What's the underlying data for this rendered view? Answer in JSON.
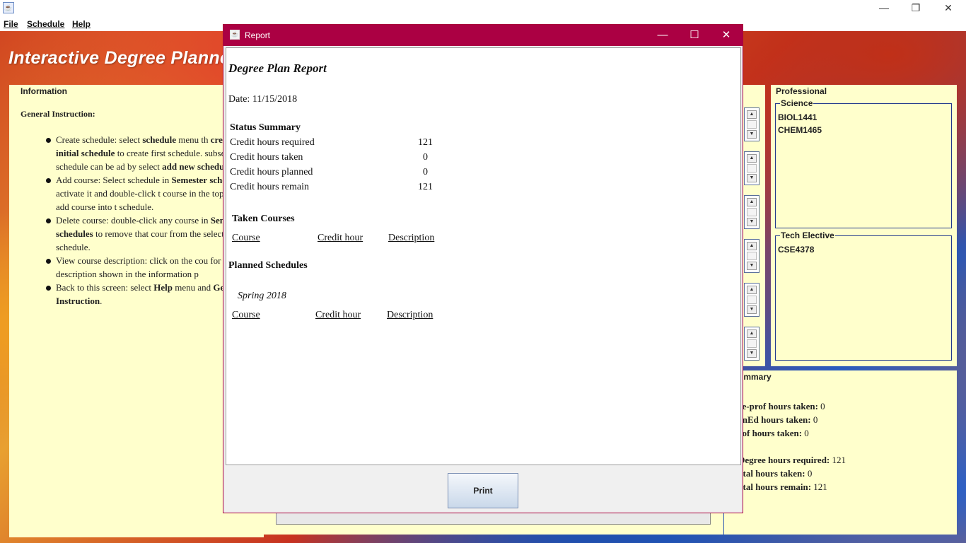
{
  "window": {
    "minimize": "—",
    "restore": "❐",
    "close": "✕"
  },
  "menu": {
    "file": "File",
    "schedule": "Schedule",
    "help": "Help"
  },
  "app_title": "Interactive Degree Planne",
  "info_panel": {
    "title": "Information",
    "general_title": "General Instruction:",
    "items": [
      {
        "pre": "Create schedule: select ",
        "b1": "schedule",
        "mid": " menu th",
        "b2": "create initial schedule",
        "tail": " to create first schedule. subsequence schedule can be ad by select ",
        "b3": "add new schedule",
        "end": ""
      },
      {
        "pre": "Add course: Select schedule in ",
        "b1": "Semester",
        "mid": " ",
        "b2": "schedules",
        "tail": " to activate it and double-click t course in the top lists to add course into t schedule.",
        "b3": "",
        "end": ""
      },
      {
        "pre": "Delete course: double-click any course in ",
        "b1": "Semester schedules",
        "mid": " to remove that cour from the selected schedule.",
        "b2": "",
        "tail": "",
        "b3": "",
        "end": ""
      },
      {
        "pre": "View course description: click on the cou for description shown in the information p",
        "b1": "",
        "mid": "",
        "b2": "",
        "tail": "",
        "b3": "",
        "end": ""
      },
      {
        "pre": "Back to this screen: select ",
        "b1": "Help",
        "mid": " menu and ",
        "b2": "General Instruction",
        "tail": ".",
        "b3": "",
        "end": ""
      }
    ]
  },
  "professional": {
    "title": "Professional",
    "science_label": "Science",
    "science_courses": [
      "BIOL1441",
      "CHEM1465"
    ],
    "tech_label": "Tech Elective",
    "tech_courses": [
      "CSE4378"
    ]
  },
  "summary": {
    "title": "ummary",
    "lines": [
      {
        "label": "re-prof hours taken:",
        "value": "0"
      },
      {
        "label": "enEd hours taken:",
        "value": "0"
      },
      {
        "label": "rof hours taken:",
        "value": "0"
      },
      {
        "label": "Degree hours required:",
        "value": "121"
      },
      {
        "label": "otal hours taken:",
        "value": "0"
      },
      {
        "label": "otal hours remain:",
        "value": "121"
      }
    ]
  },
  "dialog": {
    "title": "Report",
    "minimize": "—",
    "maximize": "☐",
    "close": "✕",
    "print_label": "Print",
    "report": {
      "heading": "Degree Plan Report",
      "date": "Date: 11/15/2018",
      "status_title": "Status Summary",
      "status_rows": [
        {
          "label": "Credit hours required",
          "value": "121"
        },
        {
          "label": "Credit hours taken",
          "value": "0"
        },
        {
          "label": "Credit hours planned",
          "value": "0"
        },
        {
          "label": "Credit hours remain",
          "value": "121"
        }
      ],
      "taken_title": "Taken Courses",
      "taken_headers": [
        "Course",
        "Credit hour",
        "Description"
      ],
      "planned_title": "Planned Schedules",
      "semester": "Spring 2018",
      "planned_headers": [
        "Course",
        "Credit hour",
        "Description"
      ]
    }
  }
}
